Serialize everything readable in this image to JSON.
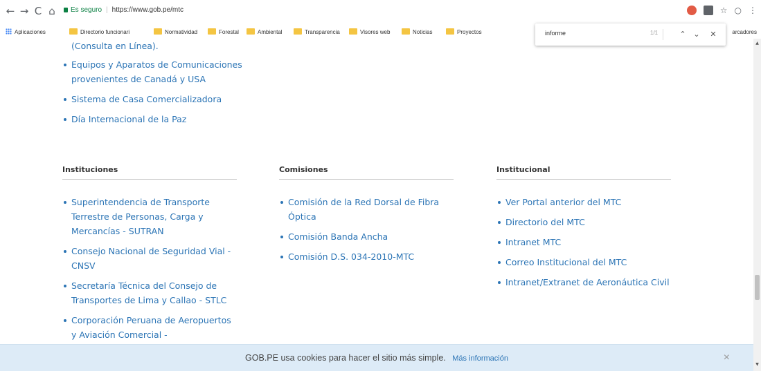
{
  "browser": {
    "back": "←",
    "forward": "→",
    "reload": "C",
    "home": "⌂",
    "secure_label": "Es seguro",
    "url": "https://www.gob.pe/mtc",
    "bookmarks": [
      {
        "label": "Aplicaciones"
      },
      {
        "label": "Directorio funcionari"
      },
      {
        "label": "Normatividad"
      },
      {
        "label": "Forestal"
      },
      {
        "label": "Ambiental"
      },
      {
        "label": "Transparencia"
      },
      {
        "label": "Visores web"
      },
      {
        "label": "Noticias"
      },
      {
        "label": "Proyectos"
      }
    ],
    "other_bookmarks": "arcadores",
    "find": {
      "query": "informe",
      "count": "1/1",
      "prev": "⌃",
      "next": "⌄",
      "close": "✕"
    },
    "menu": "⋮",
    "star": "☆",
    "circle": "○"
  },
  "page": {
    "top_partial": "(Consulta en Línea).",
    "top_links": [
      "Equipos y Aparatos de Comunicaciones provenientes de Canadá y USA",
      "Sistema de Casa Comercializadora",
      "Día Internacional de la Paz"
    ],
    "columns": [
      {
        "heading": "Instituciones",
        "links": [
          "Superintendencia de Transporte Terrestre de Personas, Carga y Mercancías - SUTRAN",
          "Consejo Nacional de Seguridad Vial - CNSV",
          "Secretaría Técnica del Consejo de Transportes de Lima y Callao - STLC",
          "Corporación Peruana de Aeropuertos y Aviación Comercial -"
        ]
      },
      {
        "heading": "Comisiones",
        "links": [
          "Comisión de la Red Dorsal de Fibra Óptica",
          "Comisión Banda Ancha",
          "Comisión D.S. 034-2010-MTC"
        ]
      },
      {
        "heading": "Institucional",
        "links": [
          "Ver Portal anterior del MTC",
          "Directorio del MTC",
          "Intranet MTC",
          "Correo Institucional del MTC",
          "Intranet/Extranet de Aeronáutica Civil"
        ]
      }
    ]
  },
  "cookie_banner": {
    "text": "GOB.PE usa cookies para hacer el sitio más simple.",
    "more_link": "Más información",
    "close": "×"
  }
}
